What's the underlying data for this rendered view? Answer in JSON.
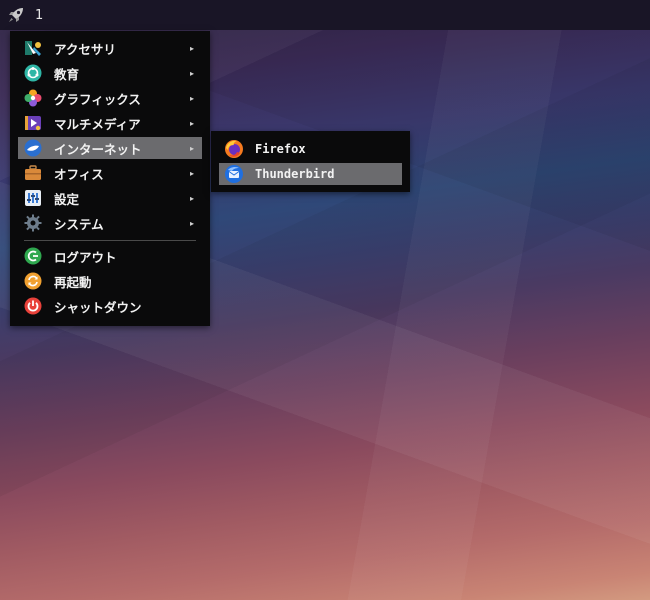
{
  "panel": {
    "workspace_number": "1",
    "launcher_icon": "rocket-icon"
  },
  "menu": {
    "items": [
      {
        "label": "アクセサリ",
        "icon": "accessories-icon",
        "has_submenu": true
      },
      {
        "label": "教育",
        "icon": "education-icon",
        "has_submenu": true
      },
      {
        "label": "グラフィックス",
        "icon": "graphics-icon",
        "has_submenu": true
      },
      {
        "label": "マルチメディア",
        "icon": "multimedia-icon",
        "has_submenu": true
      },
      {
        "label": "インターネット",
        "icon": "internet-icon",
        "has_submenu": true,
        "active": true
      },
      {
        "label": "オフィス",
        "icon": "office-icon",
        "has_submenu": true
      },
      {
        "label": "設定",
        "icon": "settings-icon",
        "has_submenu": true
      },
      {
        "label": "システム",
        "icon": "system-icon",
        "has_submenu": true
      }
    ],
    "actions": [
      {
        "label": "ログアウト",
        "icon": "logout-icon"
      },
      {
        "label": "再起動",
        "icon": "reboot-icon"
      },
      {
        "label": "シャットダウン",
        "icon": "shutdown-icon"
      }
    ]
  },
  "submenu": {
    "items": [
      {
        "label": "Firefox",
        "icon": "firefox-icon"
      },
      {
        "label": "Thunderbird",
        "icon": "thunderbird-icon",
        "active": true
      }
    ]
  },
  "colors": {
    "menu_bg": "#0a0a0b",
    "highlight": "#6b6b6e",
    "panel_bg": "#191526"
  }
}
